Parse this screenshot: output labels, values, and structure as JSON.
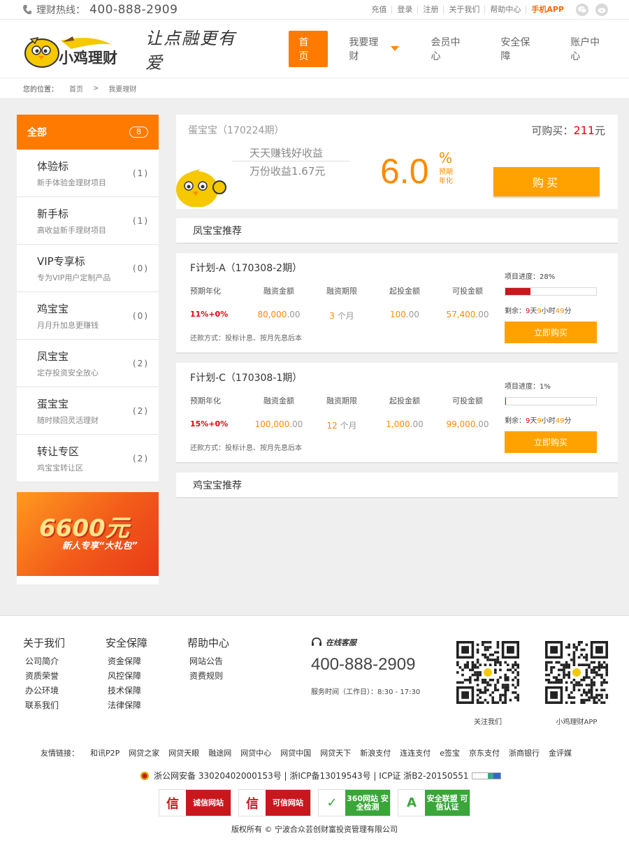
{
  "topbar": {
    "hotline_label": "理财热线：",
    "hotline_number": "400-888-2909",
    "links": [
      "充值",
      "登录",
      "注册",
      "关于我们",
      "帮助中心"
    ],
    "app_link": "手机APP"
  },
  "header": {
    "logo_text": "小鸡理财",
    "slogan": "让点融更有爱",
    "nav": {
      "home": "首页",
      "invest": "我要理财",
      "member": "会员中心",
      "security": "安全保障",
      "account": "账户中心"
    }
  },
  "breadcrumb": {
    "label": "您的位置：",
    "home": "首页",
    "sep": ">",
    "current": "我要理财"
  },
  "sidebar": {
    "all_label": "全部",
    "all_count": "8",
    "items": [
      {
        "title": "体验标",
        "sub": "新手体验金理财项目",
        "count": "(1)"
      },
      {
        "title": "新手标",
        "sub": "高收益新手理财项目",
        "count": "(1)"
      },
      {
        "title": "VIP专享标",
        "sub": "专为VIP用户定制产品",
        "count": "(0)"
      },
      {
        "title": "鸡宝宝",
        "sub": "月月升加息更赚钱",
        "count": "(0)"
      },
      {
        "title": "凤宝宝",
        "sub": "定存投资安全放心",
        "count": "(2)"
      },
      {
        "title": "蛋宝宝",
        "sub": "随时赎回灵活理财",
        "count": "(2)"
      },
      {
        "title": "转让专区",
        "sub": "鸡宝宝转让区",
        "count": "(2)"
      }
    ],
    "promo_amount": "6600元",
    "promo_sub": "新人专享“大礼包”"
  },
  "hero": {
    "name": "蛋宝宝（170224期）",
    "available_label": "可购买：",
    "available_value": "211",
    "available_unit": "元",
    "tagline1": "天天赚钱好收益",
    "tagline2": "万份收益1.67元",
    "rate": "6.0",
    "rate_unit": "%",
    "rate_label_1": "预期",
    "rate_label_2": "年化",
    "buy_label": "购买"
  },
  "sections": {
    "feng": "凤宝宝推荐",
    "ji": "鸡宝宝推荐"
  },
  "product_headers": {
    "rate": "预期年化",
    "amount": "融资金额",
    "term": "融资期限",
    "min": "起投金额",
    "avail": "可投金额"
  },
  "products": [
    {
      "title": "F计划-A（170308-2期）",
      "rate": "11%+0%",
      "amount": "80,000",
      "amount_dec": ".00",
      "term": "3",
      "term_unit": "个月",
      "min": "100",
      "min_dec": ".00",
      "avail": "57,400",
      "avail_dec": ".00",
      "repay": "还款方式：投标计息、按月先息后本",
      "progress_label": "项目进度：28%",
      "progress": 0.28,
      "remain_label": "剩余：",
      "remain_days": "9",
      "remain_hours": "9",
      "remain_minutes": "49",
      "buy_label": "立即购买"
    },
    {
      "title": "F计划-C（170308-1期）",
      "rate": "15%+0%",
      "amount": "100,000",
      "amount_dec": ".00",
      "term": "12",
      "term_unit": "个月",
      "min": "1,000",
      "min_dec": ".00",
      "avail": "99,000",
      "avail_dec": ".00",
      "repay": "还款方式：投标计息、按月先息后本",
      "progress_label": "项目进度：1%",
      "progress": 0.01,
      "remain_label": "剩余：",
      "remain_days": "9",
      "remain_hours": "9",
      "remain_minutes": "49",
      "buy_label": "立即购买"
    }
  ],
  "time_units": {
    "day": "天",
    "hour": "小时",
    "minute": "分"
  },
  "footer": {
    "about": {
      "title": "关于我们",
      "links": [
        "公司简介",
        "资质荣誉",
        "办公环境",
        "联系我们"
      ]
    },
    "security": {
      "title": "安全保障",
      "links": [
        "资金保障",
        "风控保障",
        "技术保障",
        "法律保障"
      ]
    },
    "help": {
      "title": "帮助中心",
      "links": [
        "网站公告",
        "资费规则"
      ]
    },
    "online_service": "在线客服",
    "phone": "400-888-2909",
    "hours": "服务时间（工作日）：8:30 - 17:30",
    "qr1_label": "关注我们",
    "qr2_label": "小鸡理财APP",
    "friends_label": "友情链接：",
    "friends": [
      "和讯P2P",
      "网贷之家",
      "网贷天眼",
      "融途网",
      "网贷中心",
      "网贷中国",
      "网贷天下",
      "新浪支付",
      "连连支付",
      "e签宝",
      "京东支付",
      "浙商银行",
      "金评媒"
    ],
    "icp": "浙公网安备 33020402000153号 | 浙ICP备13019543号 | ICP证 浙B2-20150551",
    "badges": [
      {
        "icon": "信",
        "text": "诚信网站",
        "color": "#c9171e"
      },
      {
        "icon": "信",
        "text": "可信网站",
        "color": "#c9171e"
      },
      {
        "icon": "✓",
        "text": "360网站 安全检测",
        "color": "#3aa63a"
      },
      {
        "icon": "A",
        "text": "安全联盟 可信认证",
        "color": "#3aa63a"
      }
    ],
    "copyright": "版权所有 © 宁波合众芸创财富投资管理有限公司"
  }
}
